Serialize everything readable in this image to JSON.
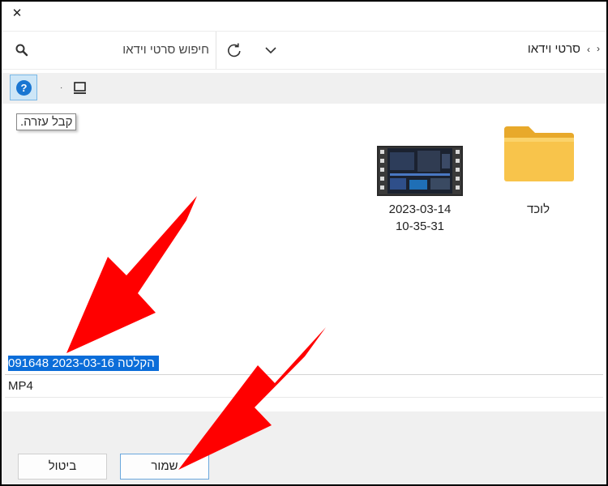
{
  "window": {
    "close_glyph": "✕"
  },
  "addressbar": {
    "search_placeholder": "חיפוש סרטי וידאו",
    "breadcrumb_current": "סרטי וידאו",
    "breadcrumb_separator": "›",
    "right_chevron": "›"
  },
  "toolbar": {
    "help_glyph": "?",
    "view_dropdown_glyph": "·"
  },
  "tooltip": {
    "text": "קבל עזרה."
  },
  "files": [
    {
      "name": "לוכד",
      "kind": "folder",
      "icon": "folder-icon"
    },
    {
      "name_line1": "2023-03-14",
      "name_line2": "10-35-31",
      "kind": "video",
      "icon": "video-thumbnail"
    }
  ],
  "save_form": {
    "filename_value": "הקלטה 2023-03-16 091648",
    "filetype_value": "MP4"
  },
  "buttons": {
    "save_label": "שמור",
    "cancel_label": "ביטול"
  },
  "colors": {
    "accent": "#0b6dd9",
    "annotation_arrow": "#ff0000",
    "folder_yellow": "#f8c44b"
  }
}
